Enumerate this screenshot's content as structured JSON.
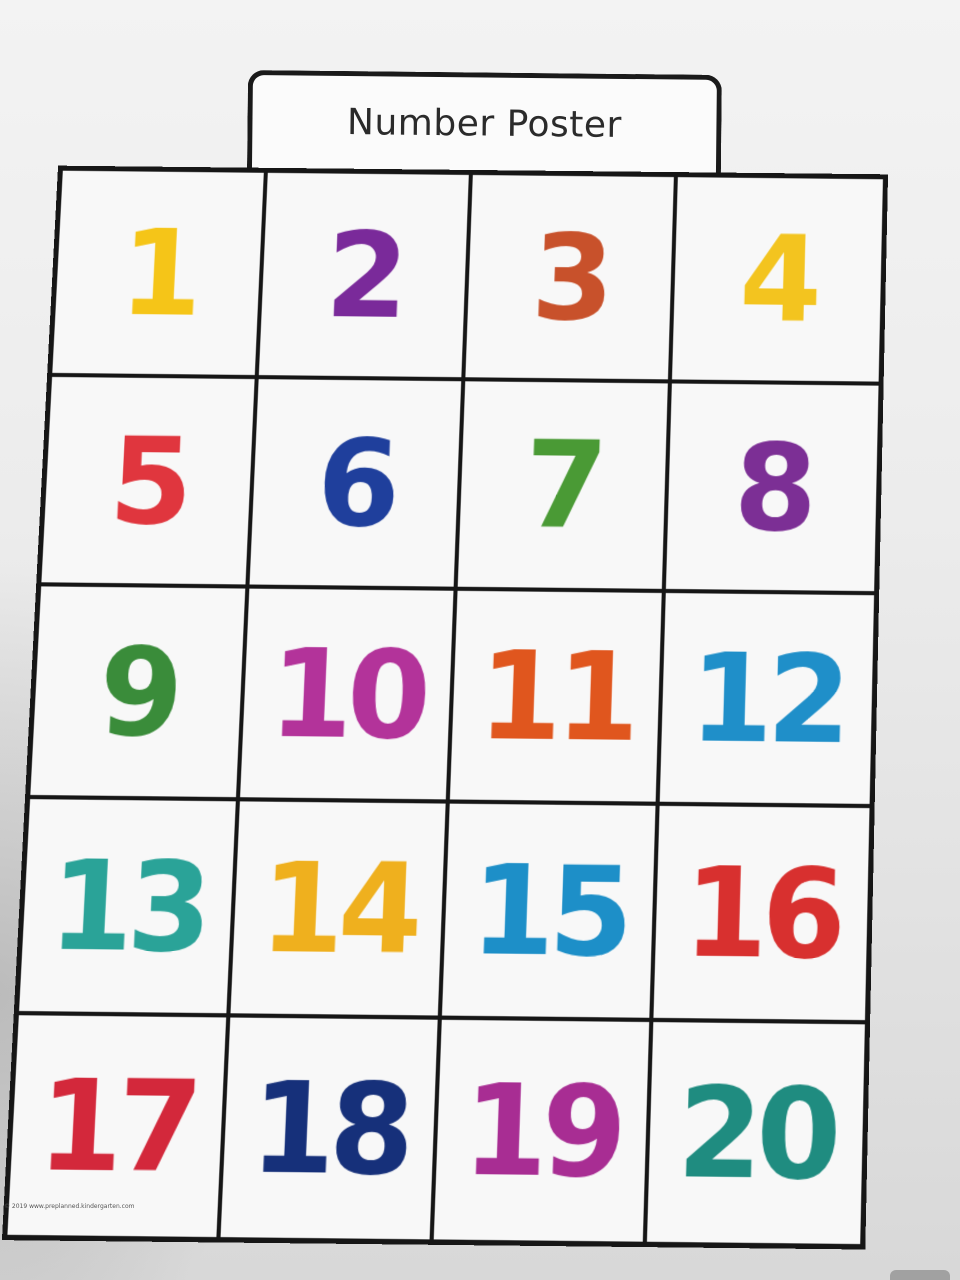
{
  "poster": {
    "title": "Number Poster",
    "footer": "© 2019 www.preplanned.kindergarten.com"
  },
  "numbers": [
    {
      "label": "1",
      "color": "#f5c518"
    },
    {
      "label": "2",
      "color": "#7a2a9a"
    },
    {
      "label": "3",
      "color": "#c8512b"
    },
    {
      "label": "4",
      "color": "#f3c41f"
    },
    {
      "label": "5",
      "color": "#e0363e"
    },
    {
      "label": "6",
      "color": "#1f3f9c"
    },
    {
      "label": "7",
      "color": "#4a9a35"
    },
    {
      "label": "8",
      "color": "#7c2f95"
    },
    {
      "label": "9",
      "color": "#3a8c3a"
    },
    {
      "label": "10",
      "color": "#b3339a"
    },
    {
      "label": "11",
      "color": "#e0561e"
    },
    {
      "label": "12",
      "color": "#1f8fc9"
    },
    {
      "label": "13",
      "color": "#2aa398"
    },
    {
      "label": "14",
      "color": "#efb01e"
    },
    {
      "label": "15",
      "color": "#1d8fc8"
    },
    {
      "label": "16",
      "color": "#d8302f"
    },
    {
      "label": "17",
      "color": "#d3283b"
    },
    {
      "label": "18",
      "color": "#16307a"
    },
    {
      "label": "19",
      "color": "#a82d93"
    },
    {
      "label": "20",
      "color": "#1f8c80"
    }
  ]
}
